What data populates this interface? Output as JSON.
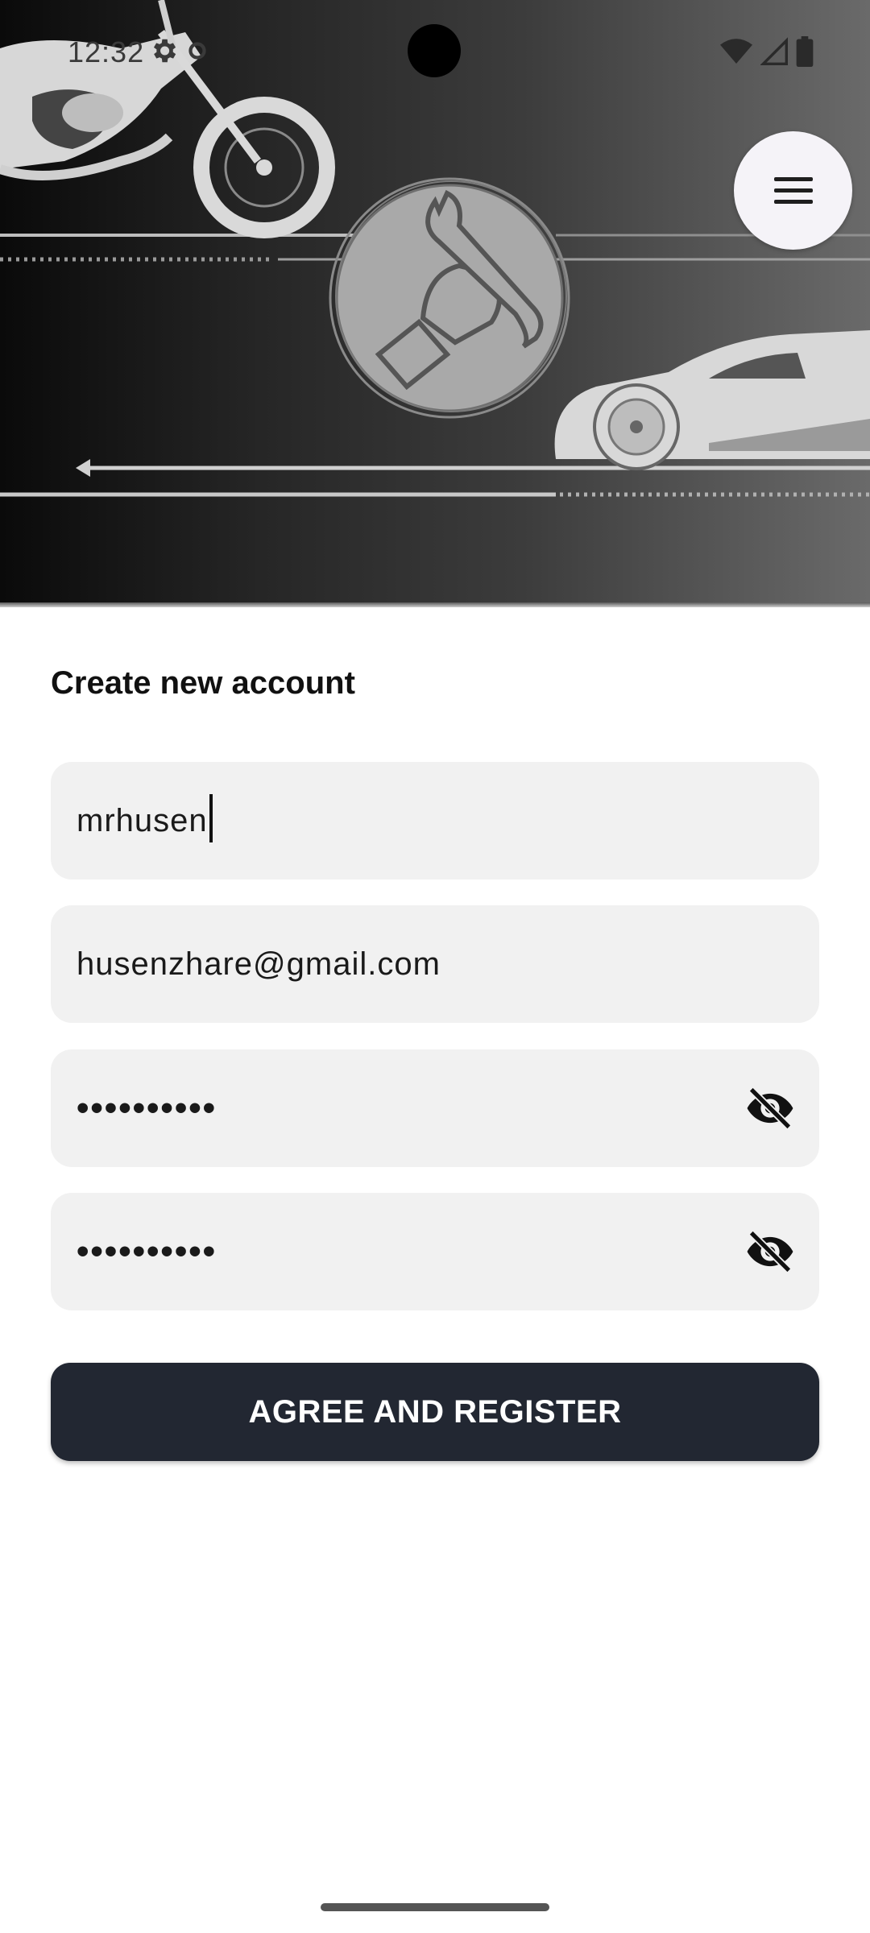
{
  "status_bar": {
    "time": "12:32",
    "icons": [
      "settings-gear-icon",
      "wifi-icon",
      "cell-signal-icon",
      "battery-icon"
    ]
  },
  "header": {
    "menu_icon": "hamburger-menu-icon",
    "banner_art": [
      "motorcycle",
      "wrench-fist-emblem",
      "sports-car",
      "speed-lines"
    ]
  },
  "form": {
    "title": "Create new account",
    "username": {
      "value": "mrhusen"
    },
    "email": {
      "value": "husenzhare@gmail.com"
    },
    "password": {
      "value": "••••••••••",
      "toggle_icon": "eye-off-icon"
    },
    "confirm_password": {
      "value": "••••••••••",
      "toggle_icon": "eye-off-icon"
    },
    "submit_label": "AGREE AND REGISTER"
  },
  "colors": {
    "field_bg": "#f1f1f1",
    "button_bg": "#222732",
    "button_text": "#ffffff",
    "fab_bg": "#f5f3f8"
  }
}
